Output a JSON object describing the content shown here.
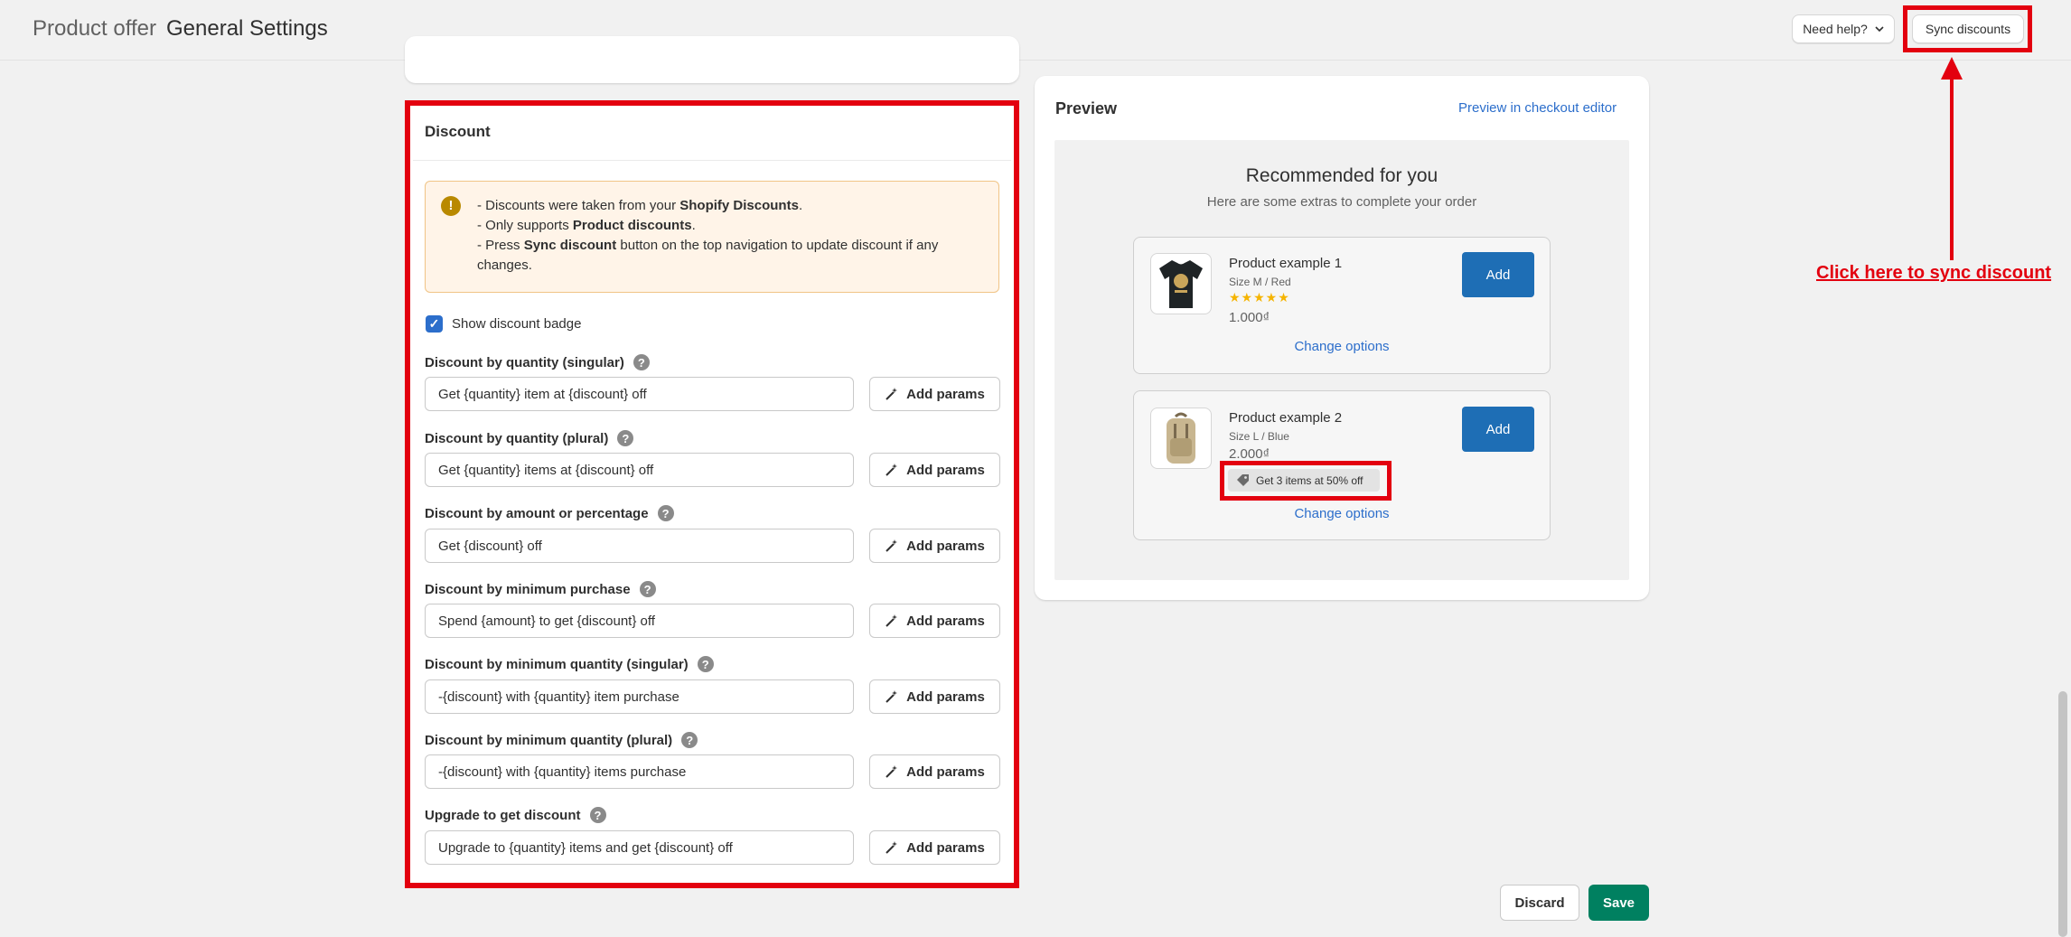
{
  "header": {
    "breadcrumb_parent": "Product offer",
    "page_title": "General Settings",
    "help_label": "Need help?",
    "sync_label": "Sync discounts"
  },
  "discount": {
    "title": "Discount",
    "banner_lines": [
      [
        "- Discounts were taken from your ",
        "Shopify Discounts",
        "."
      ],
      [
        "- Only supports ",
        "Product discounts",
        "."
      ],
      [
        "- Press ",
        "Sync discount",
        " button on the top navigation to update discount if any changes."
      ]
    ],
    "show_badge_label": "Show discount badge",
    "show_badge_checked": true,
    "add_params_label": "Add params",
    "fields": [
      {
        "label": "Discount by quantity (singular)",
        "value": "Get {quantity} item at {discount} off"
      },
      {
        "label": "Discount by quantity (plural)",
        "value": "Get {quantity} items at {discount} off"
      },
      {
        "label": "Discount by amount or percentage",
        "value": "Get {discount} off"
      },
      {
        "label": "Discount by minimum purchase",
        "value": "Spend {amount} to get {discount} off"
      },
      {
        "label": "Discount by minimum quantity (singular)",
        "value": "-{discount} with {quantity} item purchase"
      },
      {
        "label": "Discount by minimum quantity (plural)",
        "value": "-{discount} with {quantity} items purchase"
      },
      {
        "label": "Upgrade to get discount",
        "value": "Upgrade to {quantity} items and get {discount} off"
      }
    ]
  },
  "preview": {
    "title": "Preview",
    "editor_link": "Preview in checkout editor",
    "heading": "Recommended for you",
    "subheading": "Here are some extras to complete your order",
    "products": [
      {
        "name": "Product example 1",
        "variant": "Size M / Red",
        "rating": 5,
        "stars": "★★★★★",
        "price": "1.000₫",
        "add_label": "Add",
        "change_label": "Change options"
      },
      {
        "name": "Product example 2",
        "variant": "Size L / Blue",
        "price": "2.000₫",
        "badge": "Get 3 items at 50% off",
        "add_label": "Add",
        "change_label": "Change options"
      }
    ]
  },
  "annotation": {
    "note": "Click here to sync discount",
    "color": "#e3000f"
  },
  "footer": {
    "discard_label": "Discard",
    "save_label": "Save"
  },
  "colors": {
    "primary_blue": "#1e6eb5",
    "link": "#2c6ecb",
    "save_green": "#008060",
    "highlight_red": "#e3000f"
  }
}
